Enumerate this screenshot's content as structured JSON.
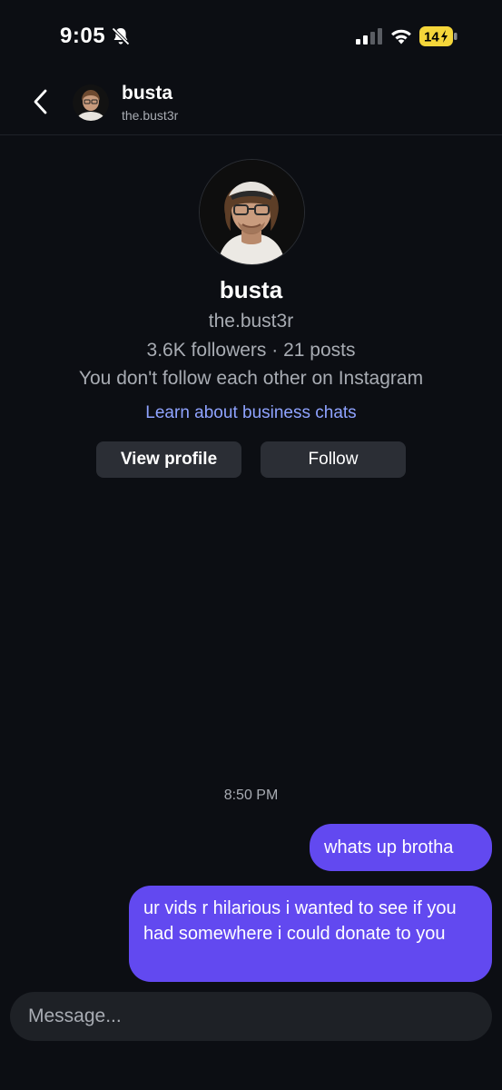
{
  "status_bar": {
    "time": "9:05",
    "battery_level": "14",
    "icons": [
      "bell-off-icon",
      "signal-icon",
      "wifi-icon",
      "battery-charging-icon"
    ]
  },
  "header": {
    "name": "busta",
    "handle": "the.bust3r"
  },
  "profile": {
    "name": "busta",
    "handle": "the.bust3r",
    "stats": "3.6K followers · 21 posts",
    "follow_note": "You don't follow each other on Instagram",
    "business_link": "Learn about business chats",
    "view_profile_label": "View profile",
    "follow_label": "Follow"
  },
  "conversation": {
    "timestamp": "8:50 PM",
    "messages": [
      {
        "sender": "me",
        "text": "whats up brotha"
      },
      {
        "sender": "me",
        "text": "ur vids r hilarious i wanted to see if you had somewhere i could donate to you"
      }
    ]
  },
  "composer": {
    "placeholder": "Message...",
    "value": ""
  },
  "colors": {
    "background": "#0c0e13",
    "bubble": "#6249f0",
    "link": "#8fa3ff",
    "button": "#2b2e35",
    "battery_fill": "#f5d63a"
  }
}
